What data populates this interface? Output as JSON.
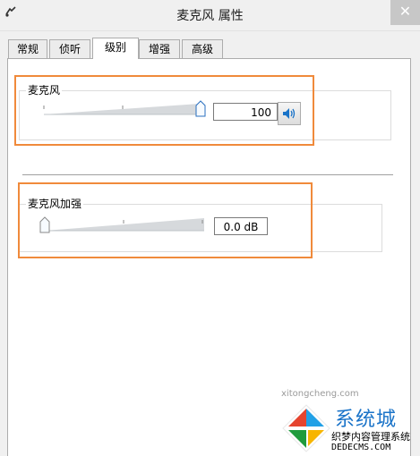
{
  "window": {
    "title": "麦克风 属性",
    "close_symbol": "✕"
  },
  "tabs": [
    {
      "label": "常规"
    },
    {
      "label": "侦听"
    },
    {
      "label": "级别",
      "active": true
    },
    {
      "label": "增强"
    },
    {
      "label": "高级"
    }
  ],
  "levels": {
    "microphone": {
      "label": "麦克风",
      "value": "100",
      "level": 1.0
    },
    "boost": {
      "label": "麦克风加强",
      "value": "0.0 dB",
      "level": 0.0
    }
  },
  "watermark": {
    "line1": "织梦内容管理系统",
    "line2": "DEDECMS.COM",
    "url": "xitongcheng.com",
    "brand_partial": "系统城"
  },
  "colors": {
    "highlight": "#f08a3b",
    "accent": "#1a73c8"
  }
}
